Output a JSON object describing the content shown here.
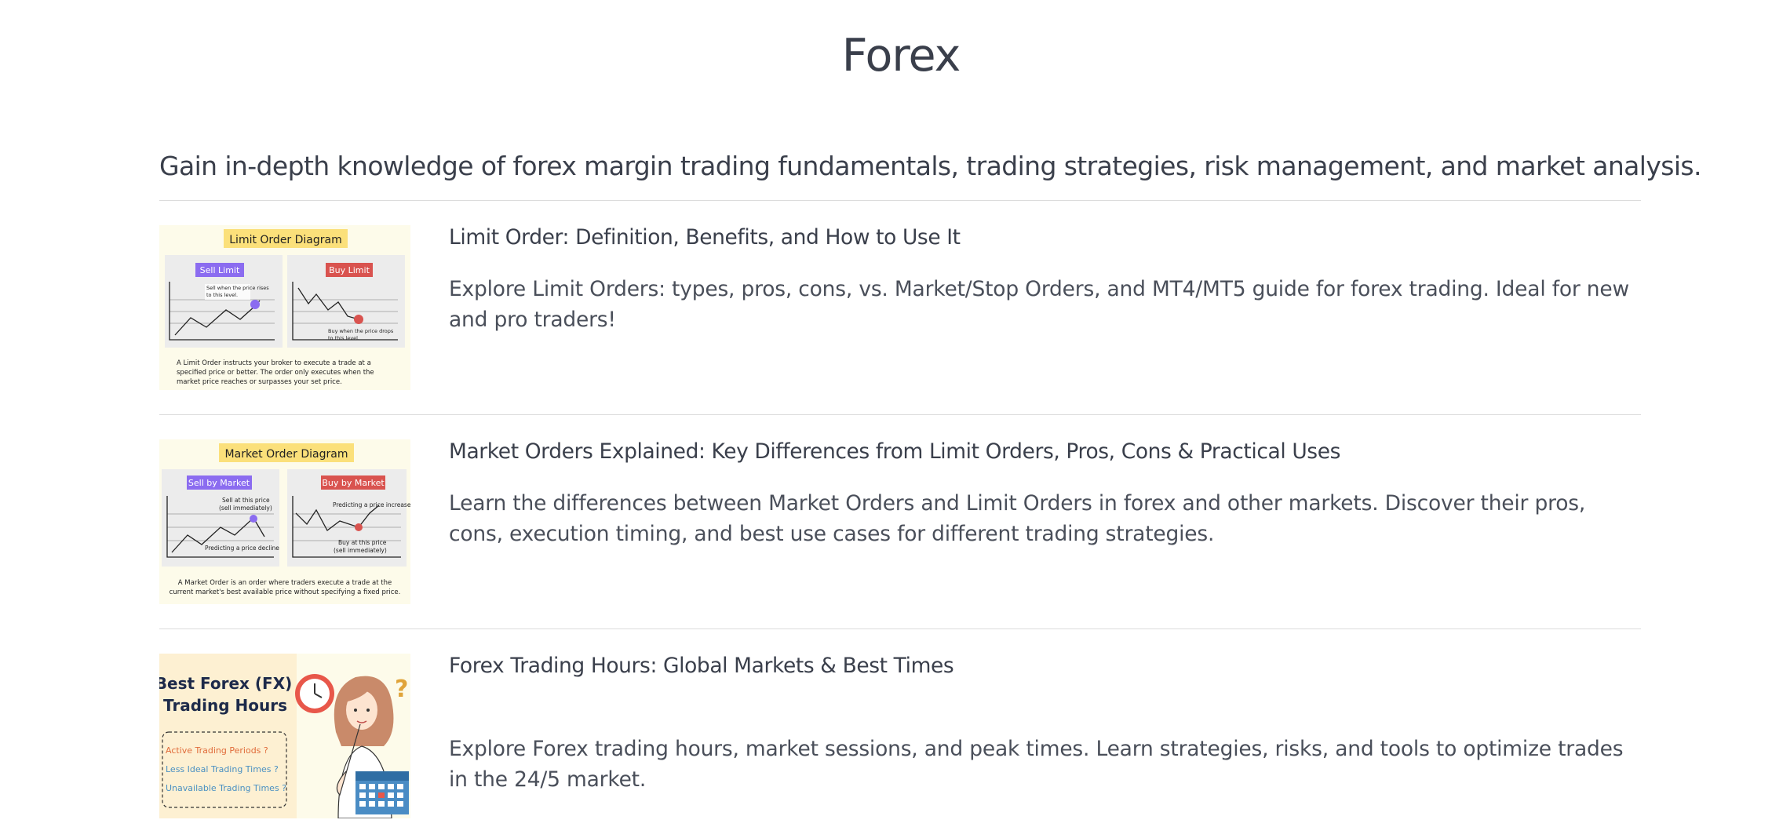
{
  "page": {
    "title": "Forex",
    "intro": "Gain in-depth knowledge of forex margin trading fundamentals, trading strategies, risk management, and market analysis."
  },
  "articles": [
    {
      "title": "Limit Order: Definition, Benefits, and How to Use It",
      "description": "Explore Limit Orders: types, pros, cons, vs. Market/Stop Orders, and MT4/MT5 guide for forex trading. Ideal for new and pro traders!",
      "thumbnail": {
        "heading": "Limit Order Diagram",
        "left_label": "Sell Limit",
        "right_label": "Buy Limit",
        "left_note_1": "Sell when the price rises",
        "left_note_2": "to this level.",
        "right_note_1": "Buy when the price drops",
        "right_note_2": "to this level.",
        "caption_1": "A Limit Order instructs your broker to execute a trade at a",
        "caption_2": "specified price or better. The order only executes when the",
        "caption_3": "market price reaches or surpasses your set price."
      }
    },
    {
      "title": "Market Orders Explained: Key Differences from Limit Orders, Pros, Cons & Practical Uses",
      "description": "Learn the differences between Market Orders and Limit Orders in forex and other markets. Discover their pros, cons, execution timing, and best use cases for different trading strategies.",
      "thumbnail": {
        "heading": "Market Order Diagram",
        "left_label": "Sell by Market",
        "right_label": "Buy by Market",
        "left_note_1": "Sell at this price",
        "left_note_2": "(sell immediately)",
        "left_note_3": "Predicting a price decline",
        "right_note_1": "Predicting a price increase",
        "right_note_2": "Buy at this price",
        "right_note_3": "(sell immediately)",
        "caption_1": "A Market Order is an order where traders  execute a trade at the",
        "caption_2": "current market's best available price without specifying a fixed price."
      }
    },
    {
      "title": "Forex Trading Hours: Global Markets & Best Times",
      "description": "Explore Forex trading hours, market sessions, and peak times. Learn strategies, risks, and tools to optimize trades in the 24/5 market.",
      "thumbnail": {
        "heading_1": "Best Forex (FX)",
        "heading_2": "Trading Hours",
        "item_1": "Active Trading Periods ?",
        "item_2": "Less Ideal Trading Times ?",
        "item_3": "Unavailable Trading Times ?"
      }
    }
  ],
  "colors": {
    "text": "#3a3f4b",
    "divider": "#dcdcdc",
    "sell_purple": "#8b6cf0",
    "buy_red": "#d9534f",
    "heading_yellow": "#fbe07a",
    "thumb_bg": "#fdfbea"
  }
}
